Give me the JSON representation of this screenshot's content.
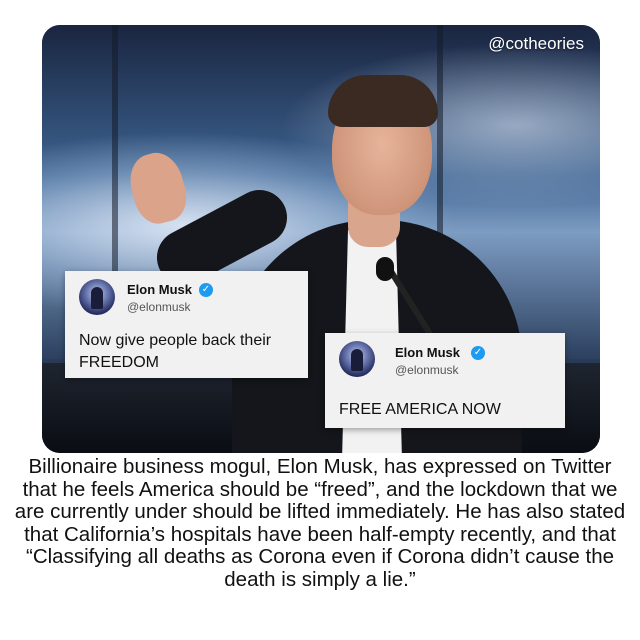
{
  "watermark": "@cotheories",
  "tweets": [
    {
      "name": "Elon Musk",
      "handle": "@elonmusk",
      "text": "Now give people back their FREEDOM",
      "verified": true
    },
    {
      "name": "Elon Musk",
      "handle": "@elonmusk",
      "text": "FREE AMERICA NOW",
      "verified": true
    }
  ],
  "caption": "Billionaire business mogul, Elon Musk, has expressed on Twitter that he feels America should be “freed”, and the lockdown that we are currently under should be lifted immediately. He has also stated that California’s hospitals have been half-empty recently, and that “Classifying all deaths as Corona even if Corona didn’t cause the death is simply a lie.”",
  "colors": {
    "verified_badge": "#1d9bf0",
    "tweet_background": "#f1f1f1",
    "text": "#111111"
  },
  "icons": {
    "verified": "check-badge-icon"
  }
}
